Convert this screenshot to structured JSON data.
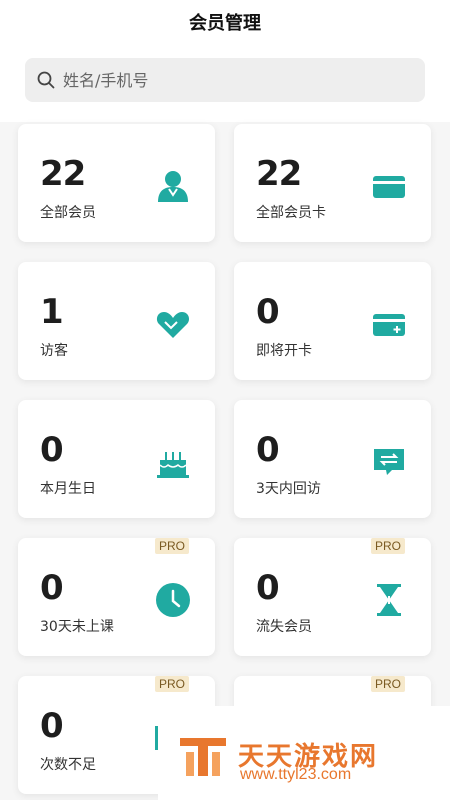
{
  "header": {
    "title": "会员管理"
  },
  "search": {
    "placeholder": "姓名/手机号"
  },
  "colors": {
    "accent": "#20aaa1",
    "pro_bg": "#f6e9cc"
  },
  "cards": [
    {
      "value": "22",
      "label": "全部会员",
      "icon": "member-icon",
      "pro": ""
    },
    {
      "value": "22",
      "label": "全部会员卡",
      "icon": "card-icon",
      "pro": ""
    },
    {
      "value": "1",
      "label": "访客",
      "icon": "handshake-heart-icon",
      "pro": ""
    },
    {
      "value": "0",
      "label": "即将开卡",
      "icon": "add-card-icon",
      "pro": ""
    },
    {
      "value": "0",
      "label": "本月生日",
      "icon": "birthday-cake-icon",
      "pro": ""
    },
    {
      "value": "0",
      "label": "3天内回访",
      "icon": "revisit-chat-icon",
      "pro": ""
    },
    {
      "value": "0",
      "label": "30天未上课",
      "icon": "clock-icon",
      "pro": "PRO"
    },
    {
      "value": "0",
      "label": "流失会员",
      "icon": "hourglass-icon",
      "pro": "PRO"
    },
    {
      "value": "0",
      "label": "次数不足",
      "icon": "count-icon",
      "pro": "PRO"
    },
    {
      "value": "",
      "label": "",
      "icon": "",
      "pro": "PRO"
    }
  ],
  "watermark": {
    "name": "天天游戏网",
    "url": "www.ttyl23.com"
  }
}
